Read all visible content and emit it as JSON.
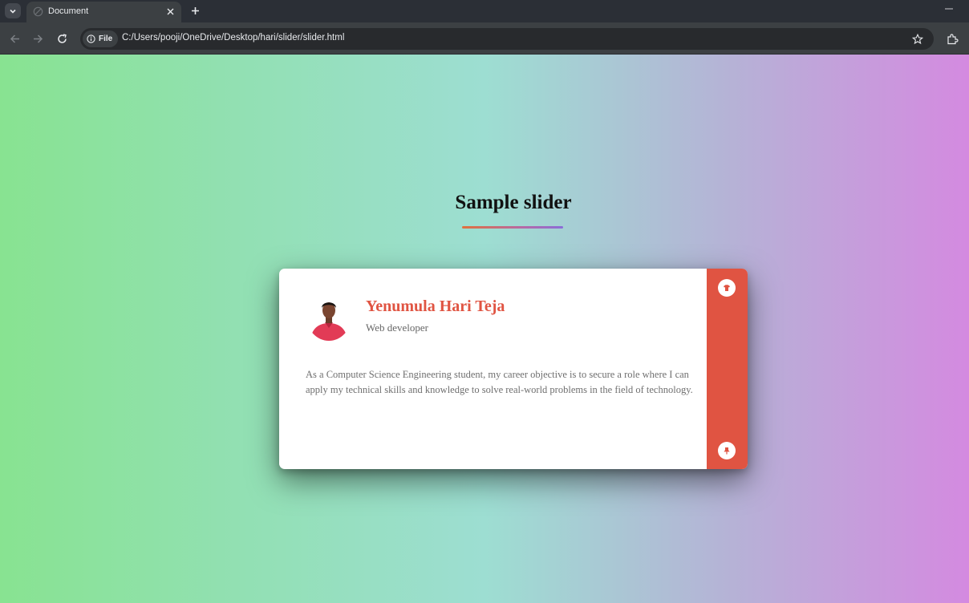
{
  "browser": {
    "tab_title": "Document",
    "address_chip": "File",
    "url": "C:/Users/pooji/OneDrive/Desktop/hari/slider/slider.html",
    "icons": [
      "tab-list-icon",
      "close-icon",
      "plus-icon",
      "minimize-icon",
      "back-icon",
      "forward-icon",
      "reload-icon",
      "info-icon",
      "star-icon",
      "extensions-icon"
    ]
  },
  "page": {
    "title": "Sample slider",
    "background_colors": [
      "#88e391",
      "#9dded2",
      "#d48ae0"
    ],
    "card": {
      "name": "Yenumula Hari Teja",
      "role": "Web developer",
      "bio": "As a Computer Science Engineering student, my career objective is to secure a role where I can apply my technical skills and knowledge to solve real-world problems in the field of technology.",
      "accent_color": "#e05442"
    }
  }
}
